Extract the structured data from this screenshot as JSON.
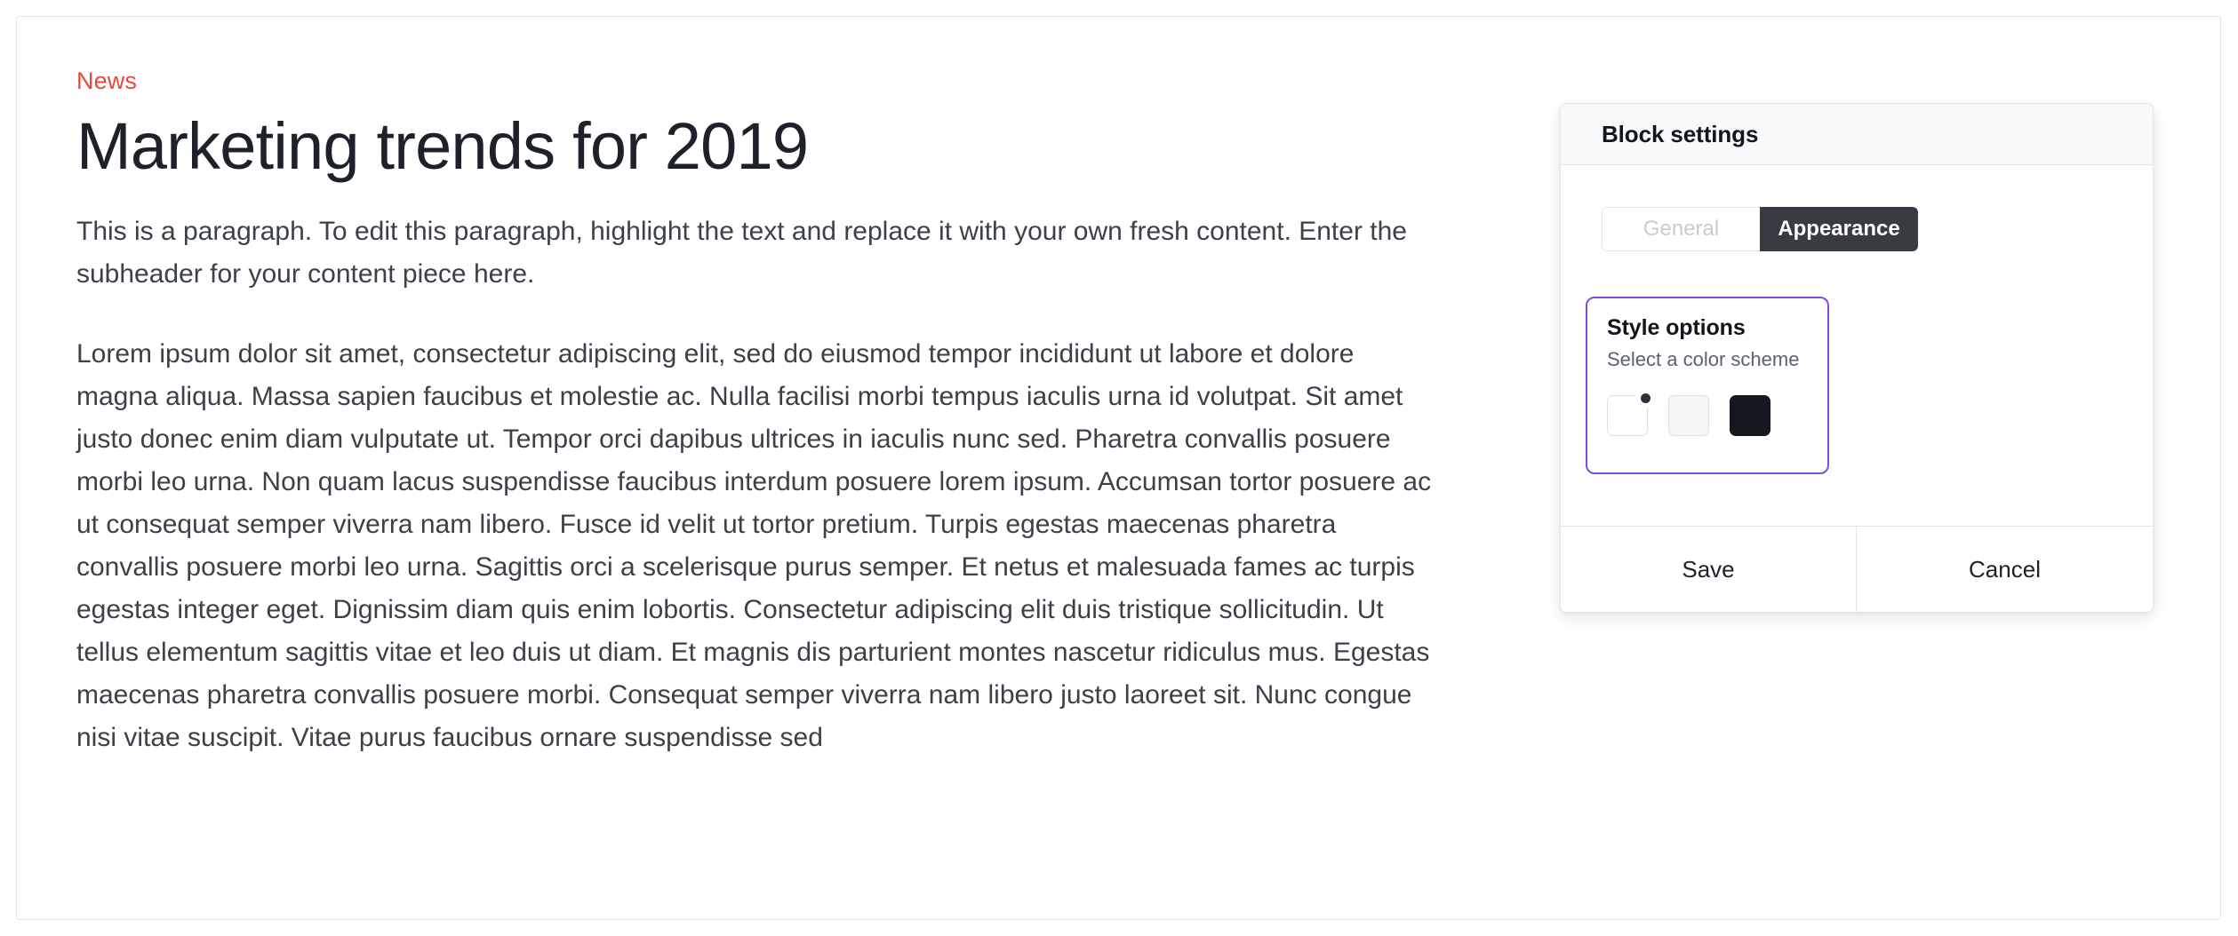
{
  "article": {
    "eyebrow": "News",
    "title": "Marketing trends for 2019",
    "intro_paragraph": "This is a paragraph. To edit this paragraph, highlight the text and replace it with your own fresh content. Enter the subheader for your content piece here.",
    "body_paragraph": "Lorem ipsum dolor sit amet, consectetur adipiscing elit, sed do eiusmod tempor incididunt ut labore et dolore magna aliqua. Massa sapien faucibus et molestie ac. Nulla facilisi morbi tempus iaculis urna id volutpat. Sit amet justo donec enim diam vulputate ut. Tempor orci dapibus ultrices in iaculis nunc sed. Pharetra convallis posuere morbi leo urna. Non quam lacus suspendisse faucibus interdum posuere lorem ipsum. Accumsan tortor posuere ac ut consequat semper viverra nam libero. Fusce id velit ut tortor pretium. Turpis egestas maecenas pharetra convallis posuere morbi leo urna. Sagittis orci a scelerisque purus semper. Et netus et malesuada fames ac turpis egestas integer eget. Dignissim diam quis enim lobortis. Consectetur adipiscing elit duis tristique sollicitudin. Ut tellus elementum sagittis vitae et leo duis ut diam. Et magnis dis parturient montes nascetur ridiculus mus. Egestas maecenas pharetra convallis posuere morbi. Consequat semper viverra nam libero justo laoreet sit. Nunc congue nisi vitae suscipit. Vitae purus faucibus ornare suspendisse sed"
  },
  "settings_panel": {
    "title": "Block settings",
    "tabs": [
      {
        "label": "General",
        "active": false
      },
      {
        "label": "Appearance",
        "active": true
      }
    ],
    "style_options": {
      "title": "Style options",
      "subtitle": "Select a color scheme",
      "swatches": [
        {
          "name": "light",
          "color": "#ffffff",
          "selected": true
        },
        {
          "name": "off-white",
          "color": "#f6f6f6",
          "selected": false
        },
        {
          "name": "dark",
          "color": "#15191f",
          "selected": false
        }
      ]
    },
    "footer": {
      "save_label": "Save",
      "cancel_label": "Cancel"
    }
  },
  "annotation": {
    "type": "callout-line-with-circle",
    "color": "#7c4ddb"
  },
  "colors": {
    "eyebrow": "#e8473f",
    "accent_purple": "#7c4ddb",
    "tab_active_bg": "#383b41",
    "body_text": "#3c4149",
    "heading": "#1d2129",
    "panel_header_bg": "#f7f9fa",
    "border": "#e3e6e9"
  }
}
